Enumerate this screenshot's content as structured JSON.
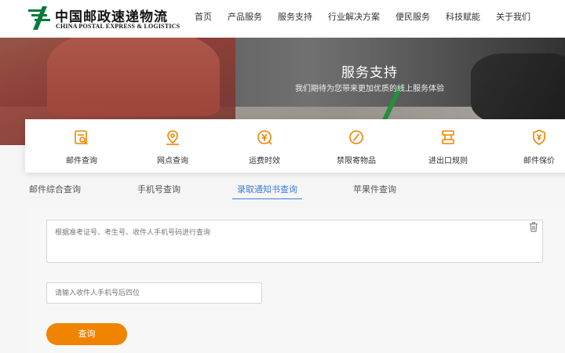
{
  "brand": {
    "name_cn": "中国邮政速递物流",
    "name_en": "CHINA POSTAL EXPRESS & LOGISTICS",
    "color_green": "#0a7a3b"
  },
  "nav": [
    "首页",
    "产品服务",
    "服务支持",
    "行业解决方案",
    "便民服务",
    "科技赋能",
    "关于我们"
  ],
  "banner": {
    "title": "服务支持",
    "subtitle": "我们期待为您带来更加优质的线上服务体验"
  },
  "services": [
    {
      "label": "邮件查询",
      "icon": "search-document-icon"
    },
    {
      "label": "网点查询",
      "icon": "map-pin-icon"
    },
    {
      "label": "运费时效",
      "icon": "yuan-clock-icon"
    },
    {
      "label": "禁限寄物品",
      "icon": "prohibited-icon"
    },
    {
      "label": "进出口规则",
      "icon": "customs-icon"
    },
    {
      "label": "邮件保价",
      "icon": "shield-yuan-icon"
    }
  ],
  "tabs": [
    "邮件综合查询",
    "手机号查询",
    "录取通知书查询",
    "苹果件查询"
  ],
  "active_tab": "录取通知书查询",
  "form": {
    "textarea_placeholder": "根据准考证号、考生号、收件人手机号码进行查询",
    "phone_placeholder": "请输入收件人手机号后四位",
    "submit_label": "查询"
  },
  "colors": {
    "accent_orange": "#f08300",
    "tab_active_blue": "#3b7fd4"
  }
}
